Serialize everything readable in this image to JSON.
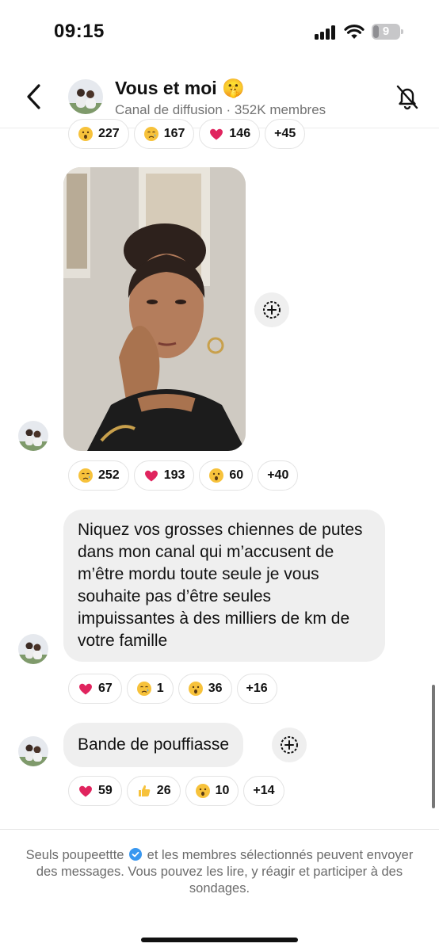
{
  "status_bar": {
    "time": "09:15",
    "battery": "9"
  },
  "header": {
    "title": "Vous et moi 🤫",
    "subtitle": "Canal de diffusion · 352K membres"
  },
  "reactions_top": [
    {
      "icon": "surprised-emoji-icon",
      "count": "227"
    },
    {
      "icon": "crying-emoji-icon",
      "count": "167"
    },
    {
      "icon": "heart-emoji-icon",
      "count": "146"
    },
    {
      "icon": "",
      "count": "+45"
    }
  ],
  "reactions_photo": [
    {
      "icon": "crying-emoji-icon",
      "count": "252"
    },
    {
      "icon": "heart-emoji-icon",
      "count": "193"
    },
    {
      "icon": "surprised-emoji-icon",
      "count": "60"
    },
    {
      "icon": "",
      "count": "+40"
    }
  ],
  "messages": [
    {
      "text": "Niquez vos grosses chiennes de putes dans mon canal qui m’accusent de m’être mordu toute seule je vous souhaite pas d’être seules impuissantes à des milliers de km de votre famille"
    },
    {
      "text": "Bande de pouffiasse"
    }
  ],
  "reactions_msg1": [
    {
      "icon": "heart-emoji-icon",
      "count": "67"
    },
    {
      "icon": "crying-emoji-icon",
      "count": "1"
    },
    {
      "icon": "surprised-emoji-icon",
      "count": "36"
    },
    {
      "icon": "",
      "count": "+16"
    }
  ],
  "reactions_msg2": [
    {
      "icon": "heart-emoji-icon",
      "count": "59"
    },
    {
      "icon": "thumbs-up-emoji-icon",
      "count": "26"
    },
    {
      "icon": "surprised-emoji-icon",
      "count": "10"
    },
    {
      "icon": "",
      "count": "+14"
    }
  ],
  "footer": {
    "prefix": "Seuls poupeettte",
    "suffix": "et les membres sélectionnés peuvent envoyer des messages. Vous pouvez les lire, y réagir et participer à des sondages."
  },
  "colors": {
    "accent": "#3897f0",
    "bubble": "#efefef",
    "heart": "#e0245e",
    "emoji_yellow": "#f7c23b"
  }
}
